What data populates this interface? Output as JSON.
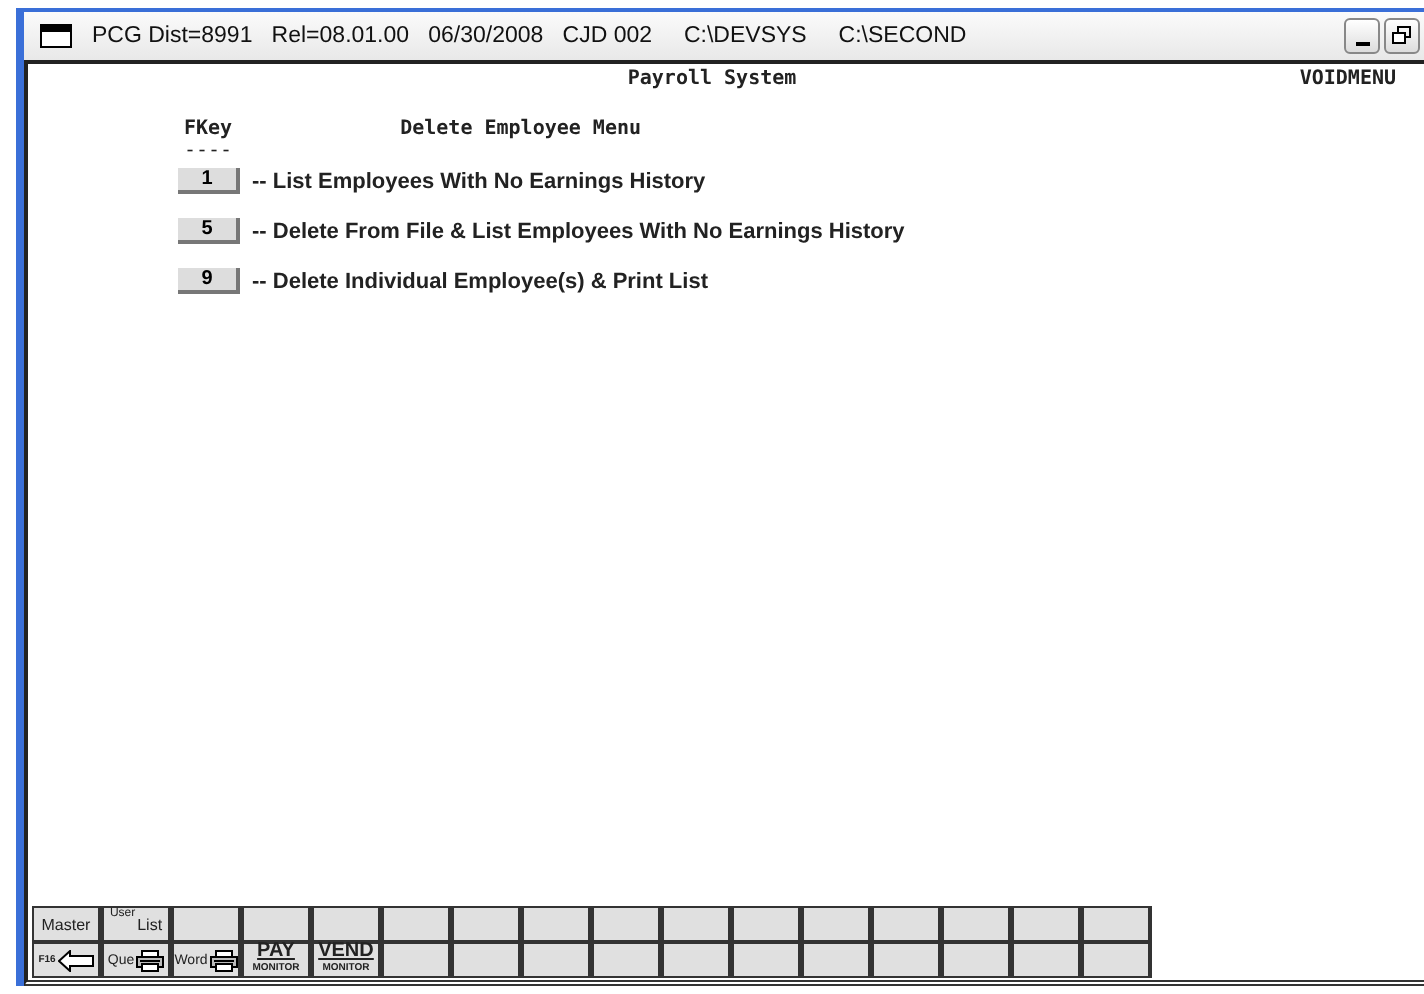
{
  "window": {
    "title": "PCG Dist=8991   Rel=08.01.00   06/30/2008   CJD 002     C:\\DEVSYS     C:\\SECOND"
  },
  "screen": {
    "system": "Payroll System",
    "screen_id": "VOIDMENU",
    "column_heading": "FKey",
    "column_rule": "----",
    "menu_title": "Delete Employee Menu"
  },
  "menu_items": [
    {
      "key": "1",
      "text": "-- List Employees With No Earnings History"
    },
    {
      "key": "5",
      "text": "-- Delete From File & List Employees With No Earnings History"
    },
    {
      "key": "9",
      "text": "-- Delete Individual Employee(s) & Print List"
    }
  ],
  "toolbar_rows": [
    [
      {
        "kind": "text",
        "label": "Master"
      },
      {
        "kind": "userlist",
        "label": "User",
        "sub": "List"
      },
      {
        "kind": "blank"
      },
      {
        "kind": "blank"
      },
      {
        "kind": "blank"
      },
      {
        "kind": "blank"
      },
      {
        "kind": "blank"
      },
      {
        "kind": "blank"
      },
      {
        "kind": "blank"
      },
      {
        "kind": "blank"
      },
      {
        "kind": "blank"
      },
      {
        "kind": "blank"
      },
      {
        "kind": "blank"
      },
      {
        "kind": "blank"
      },
      {
        "kind": "blank"
      },
      {
        "kind": "blank"
      }
    ],
    [
      {
        "kind": "back",
        "label": "F16"
      },
      {
        "kind": "print",
        "label": "Que"
      },
      {
        "kind": "print",
        "label": "Word"
      },
      {
        "kind": "monitor",
        "label": "PAY",
        "sub": "MONITOR"
      },
      {
        "kind": "monitor",
        "label": "VEND",
        "sub": "MONITOR"
      },
      {
        "kind": "blank"
      },
      {
        "kind": "blank"
      },
      {
        "kind": "blank"
      },
      {
        "kind": "blank"
      },
      {
        "kind": "blank"
      },
      {
        "kind": "blank"
      },
      {
        "kind": "blank"
      },
      {
        "kind": "blank"
      },
      {
        "kind": "blank"
      },
      {
        "kind": "blank"
      },
      {
        "kind": "blank"
      }
    ]
  ]
}
